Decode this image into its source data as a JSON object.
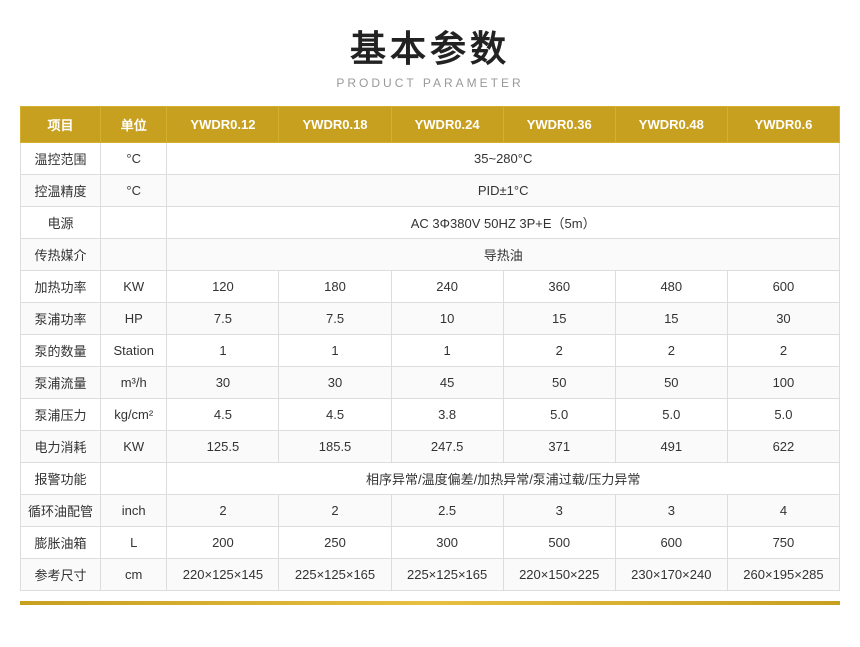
{
  "header": {
    "main_title": "基本参数",
    "sub_title": "PRODUCT PARAMETER"
  },
  "table": {
    "headers": [
      "项目",
      "单位",
      "YWDR0.12",
      "YWDR0.18",
      "YWDR0.24",
      "YWDR0.36",
      "YWDR0.48",
      "YWDR0.6"
    ],
    "rows": [
      {
        "item": "温控范围",
        "unit": "°C",
        "merged": true,
        "merged_value": "35~280°C",
        "values": []
      },
      {
        "item": "控温精度",
        "unit": "°C",
        "merged": true,
        "merged_value": "PID±1°C",
        "values": []
      },
      {
        "item": "电源",
        "unit": "",
        "merged": true,
        "merged_value": "AC 3Φ380V 50HZ 3P+E（5m）",
        "values": []
      },
      {
        "item": "传热媒介",
        "unit": "",
        "merged": true,
        "merged_value": "导热油",
        "values": []
      },
      {
        "item": "加热功率",
        "unit": "KW",
        "merged": false,
        "values": [
          "120",
          "180",
          "240",
          "360",
          "480",
          "600"
        ]
      },
      {
        "item": "泵浦功率",
        "unit": "HP",
        "merged": false,
        "values": [
          "7.5",
          "7.5",
          "10",
          "15",
          "15",
          "30"
        ]
      },
      {
        "item": "泵的数量",
        "unit": "Station",
        "merged": false,
        "values": [
          "1",
          "1",
          "1",
          "2",
          "2",
          "2"
        ]
      },
      {
        "item": "泵浦流量",
        "unit": "m³/h",
        "merged": false,
        "values": [
          "30",
          "30",
          "45",
          "50",
          "50",
          "100"
        ]
      },
      {
        "item": "泵浦压力",
        "unit": "kg/cm²",
        "merged": false,
        "values": [
          "4.5",
          "4.5",
          "3.8",
          "5.0",
          "5.0",
          "5.0"
        ]
      },
      {
        "item": "电力消耗",
        "unit": "KW",
        "merged": false,
        "values": [
          "125.5",
          "185.5",
          "247.5",
          "371",
          "491",
          "622"
        ]
      },
      {
        "item": "报警功能",
        "unit": "",
        "merged": true,
        "merged_value": "相序异常/温度偏差/加热异常/泵浦过载/压力异常",
        "values": []
      },
      {
        "item": "循环油配管",
        "unit": "inch",
        "merged": false,
        "values": [
          "2",
          "2",
          "2.5",
          "3",
          "3",
          "4"
        ]
      },
      {
        "item": "膨胀油箱",
        "unit": "L",
        "merged": false,
        "values": [
          "200",
          "250",
          "300",
          "500",
          "600",
          "750"
        ]
      },
      {
        "item": "参考尺寸",
        "unit": "cm",
        "merged": false,
        "values": [
          "220×125×145",
          "225×125×165",
          "225×125×165",
          "220×150×225",
          "230×170×240",
          "260×195×285"
        ]
      }
    ]
  }
}
